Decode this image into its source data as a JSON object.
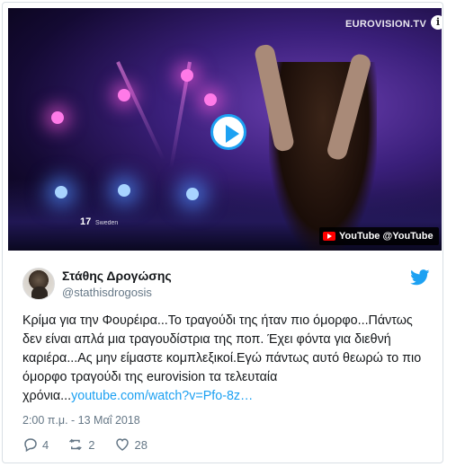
{
  "video": {
    "channel_logo": "EUROVISION.TV",
    "info_icon": "i",
    "contestant_number": "17",
    "contestant_country": "Sweden",
    "source_badge": "YouTube @YouTube"
  },
  "author": {
    "display_name": "Στάθης Δρογώσης",
    "handle": "@stathisdrogosis"
  },
  "tweet": {
    "text_main": "Κρίμα για την Φουρέιρα...Το τραγούδι της ήταν πιο όμορφο...Πάντως δεν είναι απλά μια τραγουδίστρια της ποπ. Έχει φόντα για διεθνή καριέρα...Ας μην είμαστε κομπλεξικοί.Εγώ πάντως αυτό θεωρώ το πιο όμορφο τραγούδι της eurovision τα τελευταία χρόνια...",
    "link": "youtube.com/watch?v=Pfo-8z…",
    "timestamp": "2:00 π.μ. - 13 Μαΐ 2018"
  },
  "actions": {
    "replies": "4",
    "retweets": "2",
    "likes": "28"
  },
  "colors": {
    "accent": "#1da1f2",
    "text": "#14171a",
    "muted": "#657786",
    "youtube_red": "#ff0000"
  },
  "icons": [
    "play-icon",
    "youtube-icon",
    "twitter-bird-icon",
    "reply-icon",
    "retweet-icon",
    "heart-icon",
    "info-icon"
  ]
}
